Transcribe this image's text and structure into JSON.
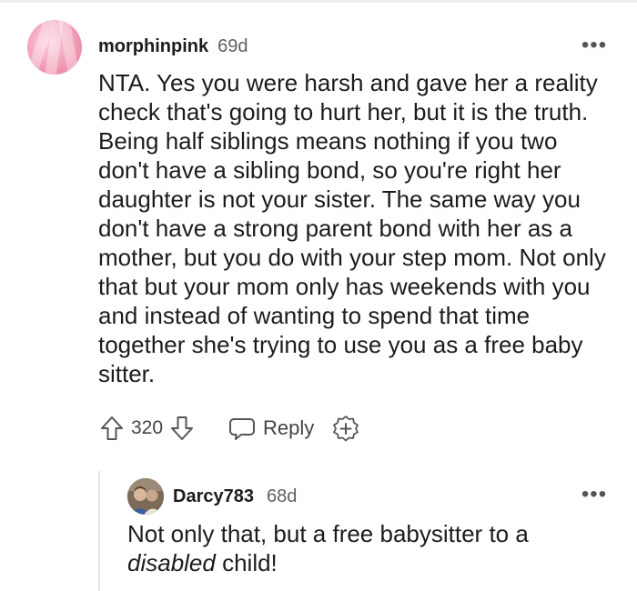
{
  "comment": {
    "author": "morphinpink",
    "age": "69d",
    "body": "NTA. Yes you were harsh and gave her a reality check that's going to hurt her, but it is the truth. Being half siblings means nothing if you two don't have a sibling bond, so you're right her daughter is not your sister. The same way you don't have a strong parent bond with her as a mother, but you do with your step mom. Not only that but your mom only has weekends with you and instead of wanting to spend that time together she's trying to use you as a free baby sitter.",
    "score": "320",
    "reply_label": "Reply",
    "more_label": "•••",
    "icons": {
      "upvote": "upvote-arrow-icon",
      "downvote": "downvote-arrow-icon",
      "reply": "speech-bubble-icon",
      "award": "add-award-icon",
      "more": "more-options-icon"
    }
  },
  "reply": {
    "author": "Darcy783",
    "age": "68d",
    "body_before": "Not only that, but a free babysitter to a ",
    "body_emphasis": "disabled",
    "body_after": " child!",
    "more_label": "•••"
  },
  "colors": {
    "text": "#1c1c1c",
    "muted": "#606060",
    "icon": "#555555",
    "thread_line": "#e6e6e6"
  }
}
